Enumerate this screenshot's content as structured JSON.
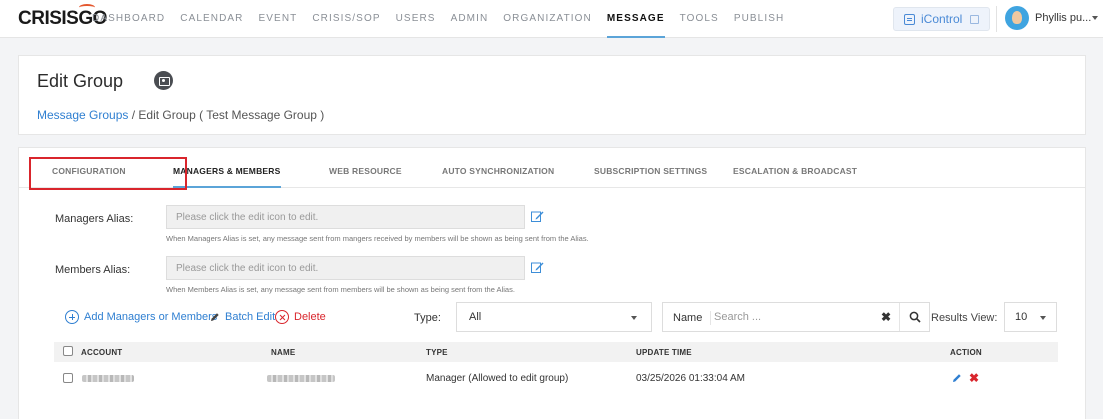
{
  "app": {
    "logo_part1": "CRISIS",
    "logo_part2": "GO"
  },
  "nav": {
    "items": [
      "DASHBOARD",
      "CALENDAR",
      "EVENT",
      "CRISIS/SOP",
      "USERS",
      "ADMIN",
      "ORGANIZATION",
      "MESSAGE",
      "TOOLS",
      "PUBLISH"
    ],
    "active": "MESSAGE",
    "icontrol_label": "iControl",
    "user_name": "Phyllis pu...",
    "accent_color": "#5ba4d8"
  },
  "header": {
    "title": "Edit Group",
    "breadcrumb_link": "Message Groups",
    "breadcrumb_current": " / Edit Group ( Test Message Group )"
  },
  "tabs": [
    "CONFIGURATION",
    "MANAGERS & MEMBERS",
    "WEB RESOURCE",
    "AUTO SYNCHRONIZATION",
    "SUBSCRIPTION SETTINGS",
    "ESCALATION & BROADCAST"
  ],
  "active_tab": "MANAGERS & MEMBERS",
  "managers_alias": {
    "label": "Managers Alias:",
    "placeholder": "Please click the edit icon to edit.",
    "hint": "When Managers Alias is set, any message sent from mangers received by members will be shown as being sent from the Alias."
  },
  "members_alias": {
    "label": "Members Alias:",
    "placeholder": "Please click the edit icon to edit.",
    "hint": "When Members Alias is set, any message sent from members will be shown as being sent from the Alias."
  },
  "toolbar": {
    "add_label": "Add Managers or Members",
    "batch_edit_label": "Batch Edit",
    "delete_label": "Delete",
    "type_label": "Type:",
    "type_value": "All",
    "name_label": "Name",
    "search_placeholder": "Search ...",
    "results_label": "Results View:",
    "results_value": "10",
    "highlight_color": "#d9252c"
  },
  "table": {
    "headers": [
      "ACCOUNT",
      "NAME",
      "TYPE",
      "UPDATE TIME",
      "ACTION"
    ],
    "rows": [
      {
        "type": "Manager (Allowed to edit group)",
        "update_time": "03/25/2026 01:33:04 AM"
      }
    ]
  }
}
